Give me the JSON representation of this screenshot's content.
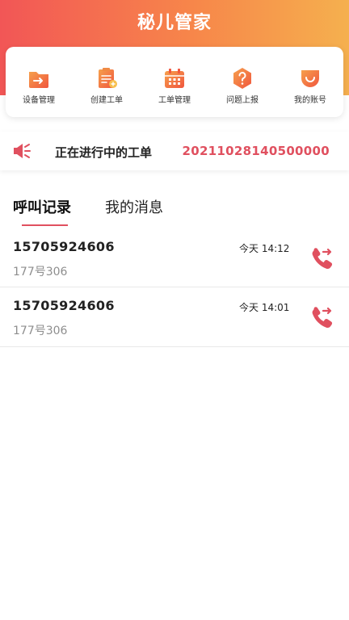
{
  "header": {
    "title": "秘儿管家"
  },
  "quick_actions": [
    {
      "label": "设备管理",
      "icon": "folder-arrow-icon"
    },
    {
      "label": "创建工单",
      "icon": "clipboard-icon"
    },
    {
      "label": "工单管理",
      "icon": "calendar-icon"
    },
    {
      "label": "问题上报",
      "icon": "question-hexagon-icon"
    },
    {
      "label": "我的账号",
      "icon": "smile-badge-icon"
    }
  ],
  "ongoing": {
    "label": "正在进行中的工单",
    "number": "20211028140500000"
  },
  "tabs": [
    {
      "label": "呼叫记录",
      "active": true
    },
    {
      "label": "我的消息",
      "active": false
    }
  ],
  "calls": [
    {
      "number": "15705924606",
      "address": "177号306",
      "time": "今天 14:12"
    },
    {
      "number": "15705924606",
      "address": "177号306",
      "time": "今天 14:01"
    }
  ],
  "colors": {
    "header_start": "#f25656",
    "header_end": "#f5b04e",
    "accent": "#e0505f",
    "icon_orange": "#f0703e"
  }
}
